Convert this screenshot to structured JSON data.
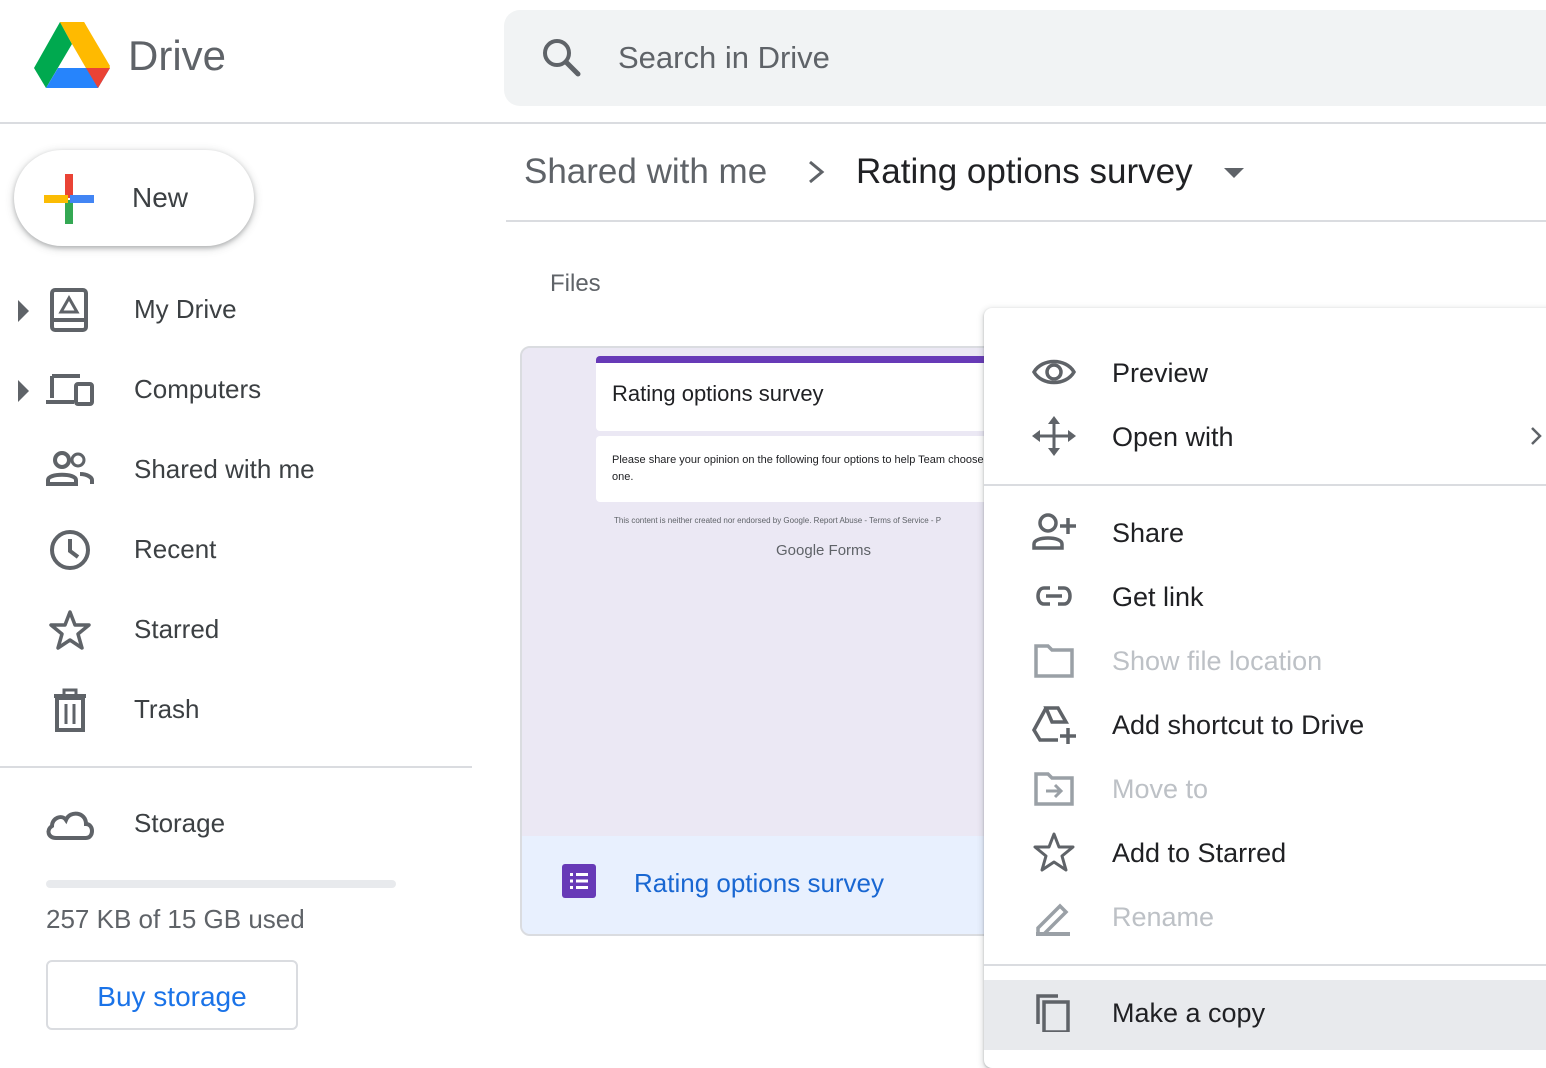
{
  "header": {
    "app_title": "Drive",
    "search_placeholder": "Search in Drive",
    "logo_icon": "google-drive-logo"
  },
  "sidebar": {
    "new_label": "New",
    "items": [
      {
        "label": "My Drive",
        "icon": "my-drive-icon",
        "expandable": true
      },
      {
        "label": "Computers",
        "icon": "computers-icon",
        "expandable": true
      },
      {
        "label": "Shared with me",
        "icon": "shared-with-me-icon",
        "expandable": false
      },
      {
        "label": "Recent",
        "icon": "clock-icon",
        "expandable": false
      },
      {
        "label": "Starred",
        "icon": "star-icon",
        "expandable": false
      },
      {
        "label": "Trash",
        "icon": "trash-icon",
        "expandable": false
      }
    ],
    "storage": {
      "label": "Storage",
      "used_text": "257 KB of 15 GB used",
      "used_fraction": 0.0,
      "buy_label": "Buy storage"
    }
  },
  "breadcrumb": {
    "parent": "Shared with me",
    "current": "Rating options survey"
  },
  "files": {
    "heading": "Files",
    "card": {
      "thumbnail": {
        "title": "Rating options survey",
        "description": "Please share your opinion on the following four options to help Team choose one.",
        "disclaimer": "This content is neither created nor endorsed by Google. Report Abuse - Terms of Service - P",
        "brand": "Google Forms"
      },
      "name": "Rating options survey",
      "type_icon": "google-forms-icon"
    }
  },
  "context_menu": {
    "items": [
      {
        "label": "Preview",
        "icon": "eye-icon",
        "disabled": false
      },
      {
        "label": "Open with",
        "icon": "move-arrows-icon",
        "disabled": false,
        "submenu": true
      },
      {
        "label": "Share",
        "icon": "person-add-icon",
        "disabled": false
      },
      {
        "label": "Get link",
        "icon": "link-icon",
        "disabled": false
      },
      {
        "label": "Show file location",
        "icon": "folder-icon",
        "disabled": true
      },
      {
        "label": "Add shortcut to Drive",
        "icon": "add-shortcut-icon",
        "disabled": false
      },
      {
        "label": "Move to",
        "icon": "move-to-folder-icon",
        "disabled": true
      },
      {
        "label": "Add to Starred",
        "icon": "star-icon",
        "disabled": false
      },
      {
        "label": "Rename",
        "icon": "pencil-icon",
        "disabled": true
      },
      {
        "label": "Make a copy",
        "icon": "copy-icon",
        "disabled": false,
        "highlighted": true
      }
    ]
  },
  "colors": {
    "accent": "#1a73e8",
    "link": "#1967d2",
    "forms_purple": "#673ab7",
    "disabled_text": "#bdc1c6"
  }
}
